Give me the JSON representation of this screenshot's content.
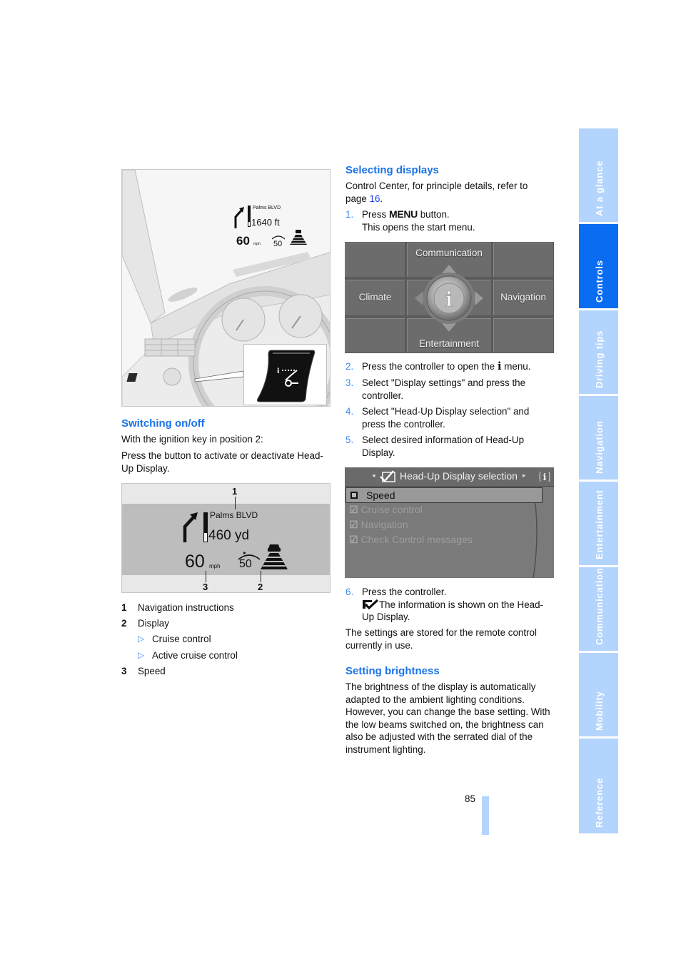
{
  "side_tabs": [
    {
      "label": "At a glance",
      "active": false
    },
    {
      "label": "Controls",
      "active": true
    },
    {
      "label": "Driving tips",
      "active": false
    },
    {
      "label": "Navigation",
      "active": false
    },
    {
      "label": "Entertainment",
      "active": false
    },
    {
      "label": "Communication",
      "active": false
    },
    {
      "label": "Mobility",
      "active": false
    },
    {
      "label": "Reference",
      "active": false
    }
  ],
  "colors": {
    "heading_blue": "#1a73e8",
    "tab_inactive": "#b3d4fc",
    "tab_active": "#0a6cf0",
    "step_number": "#3a8df0"
  },
  "figure_cockpit": {
    "hud": {
      "street": "Palms BLVD",
      "distance": "1640 ft",
      "speed": "60",
      "speed_unit": "mph",
      "cruise_speed": "50"
    },
    "button_icon": "head-up-display-button-icon"
  },
  "switching": {
    "heading": "Switching on/off",
    "para1": "With the ignition key in position 2:",
    "para2": "Press the button to activate or deactivate Head-Up Display."
  },
  "figure_hud": {
    "street": "Palms BLVD",
    "distance": "460 yd",
    "speed": "60",
    "speed_unit": "mph",
    "cruise_speed": "50",
    "callouts": [
      "1",
      "2",
      "3"
    ]
  },
  "legend": [
    {
      "n": "1",
      "text": "Navigation instructions"
    },
    {
      "n": "2",
      "text": "Display"
    },
    {
      "sub": true,
      "text": "Cruise control"
    },
    {
      "sub": true,
      "text": "Active cruise control"
    },
    {
      "n": "3",
      "text": "Speed"
    }
  ],
  "selecting": {
    "heading": "Selecting displays",
    "intro_a": "Control Center, for principle details, refer to page ",
    "intro_link": "16",
    "intro_b": ".",
    "step1_a": "Press ",
    "step1_menu": "MENU",
    "step1_b": " button.",
    "step1_c": "This opens the start menu.",
    "step2_a": "Press the controller to open the ",
    "step2_b": " menu.",
    "step3": "Select \"Display settings\" and press the controller.",
    "step4": "Select \"Head-Up Display selection\" and press the controller.",
    "step5": "Select desired information of Head-Up Display.",
    "step6_a": "Press the controller.",
    "step6_b": "The information is shown on the Head-Up Display.",
    "stored": "The settings are stored for the remote control currently in use.",
    "numbers": [
      "1.",
      "2.",
      "3.",
      "4.",
      "5.",
      "6."
    ]
  },
  "start_menu": {
    "top": "Communication",
    "left": "Climate",
    "right": "Navigation",
    "bottom": "Entertainment",
    "center_icon": "info-i-icon"
  },
  "hud_menu": {
    "title": "Head-Up Display selection",
    "items": [
      {
        "label": "Speed",
        "selected": true,
        "checked": false
      },
      {
        "label": "Cruise control",
        "selected": false,
        "checked": true
      },
      {
        "label": "Navigation",
        "selected": false,
        "checked": true
      },
      {
        "label": "Check Control messages",
        "selected": false,
        "checked": true
      }
    ]
  },
  "brightness": {
    "heading": "Setting brightness",
    "para": "The brightness of the display is automatically adapted to the ambient lighting conditions. However, you can change the base setting. With the low beams switched on, the brightness can also be adjusted with the serrated dial of the instrument lighting."
  },
  "page_number": "85"
}
